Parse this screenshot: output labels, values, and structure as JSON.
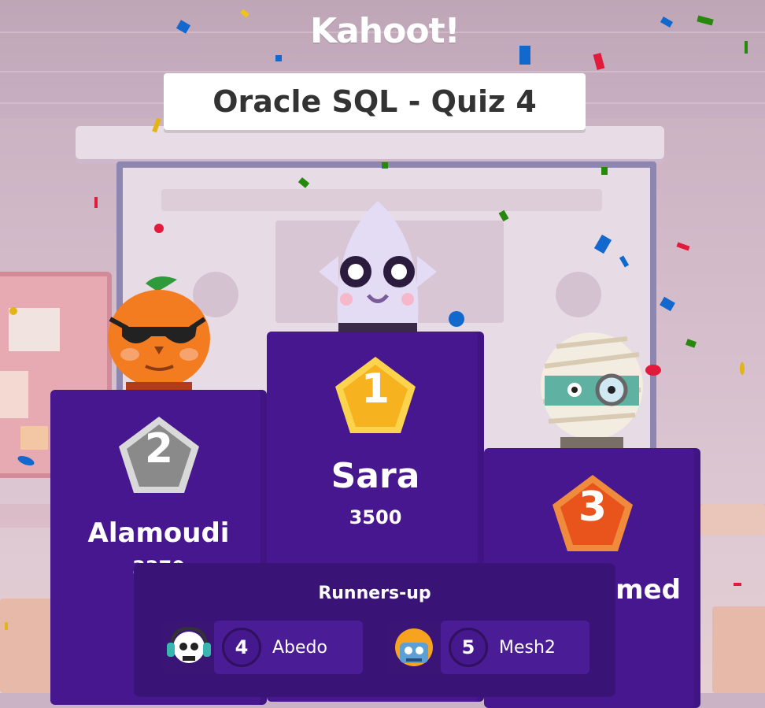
{
  "app": {
    "logo_text": "Kahoot!"
  },
  "quiz": {
    "title": "Oracle SQL - Quiz 4"
  },
  "colors": {
    "podium": "#46178f",
    "runners_panel": "#391476",
    "gold": "#f7b21f",
    "silver": "#8a8a8a",
    "bronze": "#e8541c"
  },
  "podium": {
    "first": {
      "rank": "1",
      "name": "Sara",
      "score": "3500",
      "avatar_icon": "ghost-avatar-icon"
    },
    "second": {
      "rank": "2",
      "name": "Alamoudi",
      "score": "3370",
      "avatar_icon": "pumpkin-avatar-icon"
    },
    "third": {
      "rank": "3",
      "name": "med",
      "avatar_icon": "mummy-avatar-icon"
    }
  },
  "runners_up": {
    "title": "Runners-up",
    "items": [
      {
        "rank": "4",
        "name": "Abedo",
        "avatar_icon": "skull-headphones-icon"
      },
      {
        "rank": "5",
        "name": "Mesh2",
        "avatar_icon": "robot-helmet-icon"
      }
    ]
  }
}
